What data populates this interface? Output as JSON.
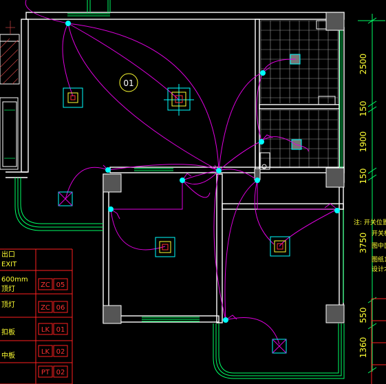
{
  "drawing": {
    "room_tag": "01",
    "dimensions": [
      "2500",
      "150",
      "1900",
      "150",
      "3750",
      "550",
      "1360"
    ],
    "legend_fragments": [
      "出口",
      "EXIT",
      "600mm",
      "顶灯",
      "顶灯",
      "扣板",
      "中板"
    ],
    "legend_codes": [
      {
        "code": "ZC",
        "num": "05"
      },
      {
        "code": "ZC",
        "num": "06"
      },
      {
        "code": "LK",
        "num": "01"
      },
      {
        "code": "LK",
        "num": "02"
      },
      {
        "code": "PT",
        "num": "02"
      }
    ],
    "notes": [
      "注: 开关位置",
      "开关板",
      "图中面",
      "图纸1",
      "设计才"
    ]
  },
  "colors": {
    "background": "#000000",
    "wall": "#ffffff",
    "window": "#00ff66",
    "wire": "#e000e0",
    "fixture": "#00ffff",
    "legend_line": "#ff2020",
    "dimension_text": "#ffff33"
  }
}
